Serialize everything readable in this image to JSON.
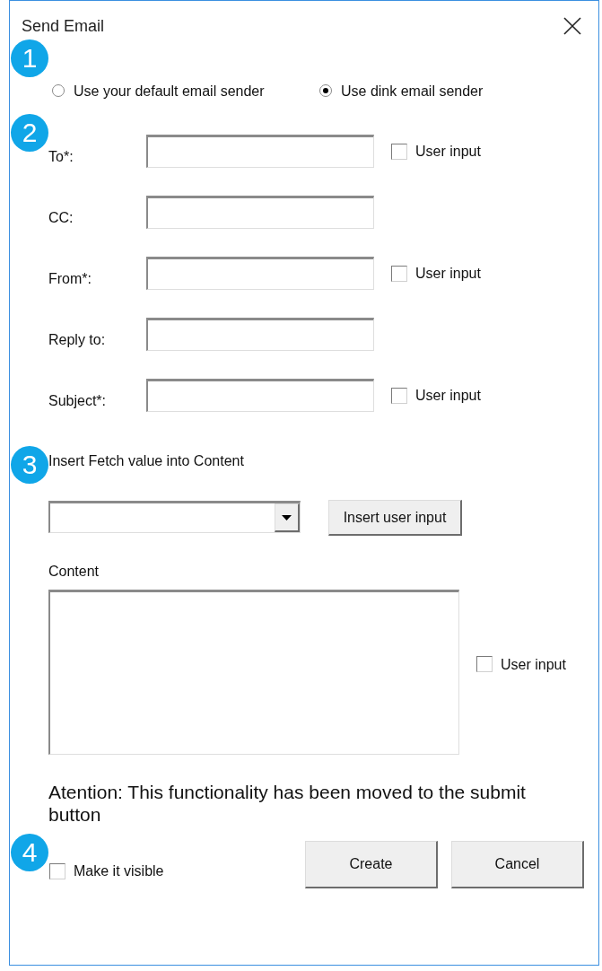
{
  "window": {
    "title": "Send Email"
  },
  "sender": {
    "marker": "1",
    "options": [
      {
        "label": "Use your default email sender",
        "selected": false
      },
      {
        "label": "Use dink email sender",
        "selected": true
      }
    ]
  },
  "fields": {
    "marker": "2",
    "rows": [
      {
        "label": "To*:",
        "user_input": {
          "label": "User input",
          "checked": false
        }
      },
      {
        "label": "CC:"
      },
      {
        "label": "From*:",
        "user_input": {
          "label": "User input",
          "checked": false
        }
      },
      {
        "label": "Reply to:"
      },
      {
        "label": "Subject*:",
        "user_input": {
          "label": "User input",
          "checked": false
        }
      }
    ]
  },
  "fetch": {
    "marker": "3",
    "label": "Insert Fetch value into Content",
    "insert_button": "Insert user input",
    "content_label": "Content",
    "content_user_input": {
      "label": "User input",
      "checked": false
    }
  },
  "notice": "Atention: This functionality has been moved to the submit button",
  "footer": {
    "marker": "4",
    "make_visible": {
      "label": "Make it visible",
      "checked": false
    },
    "buttons": [
      "Create",
      "Cancel"
    ]
  }
}
